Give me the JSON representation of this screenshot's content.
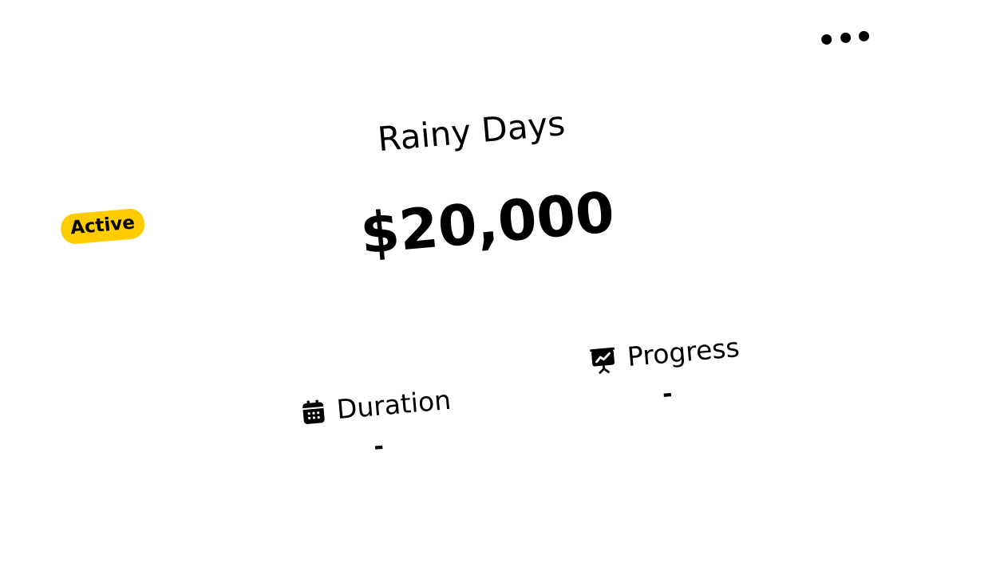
{
  "card": {
    "status_badge": "Active",
    "menu_icon": "more-horizontal-icon",
    "title": "Rainy Days",
    "amount": "$20,000",
    "stats": {
      "duration": {
        "label": "Duration",
        "icon": "calendar-icon",
        "value": "-"
      },
      "progress": {
        "label": "Progress",
        "icon": "presentation-chart-icon",
        "value": "-"
      }
    }
  },
  "colors": {
    "badge_background": "#ffcc00",
    "text": "#000000",
    "background": "#ffffff"
  }
}
